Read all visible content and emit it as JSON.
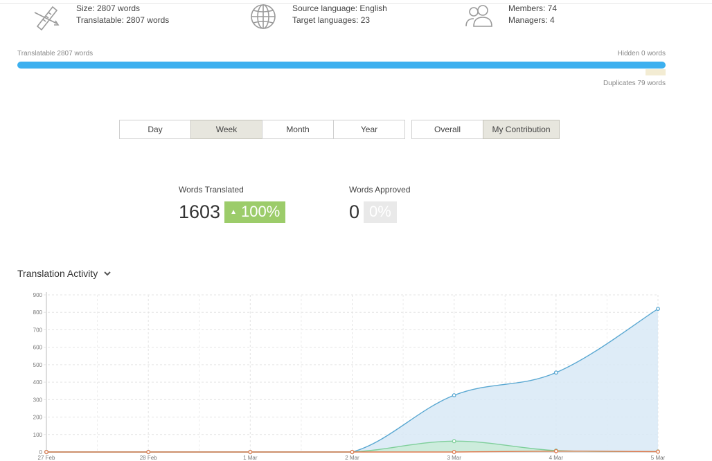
{
  "summary": {
    "size": "Size: 2807 words",
    "translatable": "Translatable: 2807 words",
    "source_language": "Source language: English",
    "target_languages": "Target languages: 23",
    "members": "Members: 74",
    "managers": "Managers: 4"
  },
  "progress": {
    "translatable_label": "Translatable 2807 words",
    "hidden_label": "Hidden 0 words",
    "duplicates_label": "Duplicates 79 words",
    "translatable_fraction": 1.0,
    "bar_color": "#3db0ef",
    "duplicates_color": "#f3ecd3"
  },
  "period_buttons": [
    {
      "label": "Day",
      "active": false
    },
    {
      "label": "Week",
      "active": true
    },
    {
      "label": "Month",
      "active": false
    },
    {
      "label": "Year",
      "active": false
    }
  ],
  "scope_buttons": [
    {
      "label": "Overall",
      "active": false
    },
    {
      "label": "My Contribution",
      "active": true
    }
  ],
  "stats": {
    "translated": {
      "label": "Words Translated",
      "value": "1603",
      "change": "100%",
      "up_color": "#9ccc6a"
    },
    "approved": {
      "label": "Words Approved",
      "value": "0",
      "change": "0%"
    }
  },
  "activity": {
    "title": "Translation Activity"
  },
  "icons": {
    "size": "ruler-pen-icon",
    "languages": "globe-icon",
    "members": "people-icon",
    "toggle": "chevron-down-icon"
  },
  "chart_data": {
    "type": "area",
    "x": [
      "27 Feb",
      "28 Feb",
      "1 Mar",
      "2 Mar",
      "3 Mar",
      "4 Mar",
      "5 Mar"
    ],
    "ylim": [
      0,
      900
    ],
    "yticks": [
      0,
      100,
      200,
      300,
      400,
      500,
      600,
      700,
      800,
      900
    ],
    "grid": true,
    "series": [
      {
        "color": "#5aa8d2",
        "fill": "#d8e9f6",
        "values": [
          0,
          0,
          0,
          0,
          325,
          455,
          820
        ]
      },
      {
        "color": "#7fcf9b",
        "fill": "#c9ecd7",
        "values": [
          0,
          0,
          0,
          0,
          62,
          8,
          3
        ]
      },
      {
        "color": "#e07a4f",
        "fill": "none",
        "values": [
          0,
          0,
          0,
          0,
          0,
          5,
          2
        ]
      }
    ]
  }
}
